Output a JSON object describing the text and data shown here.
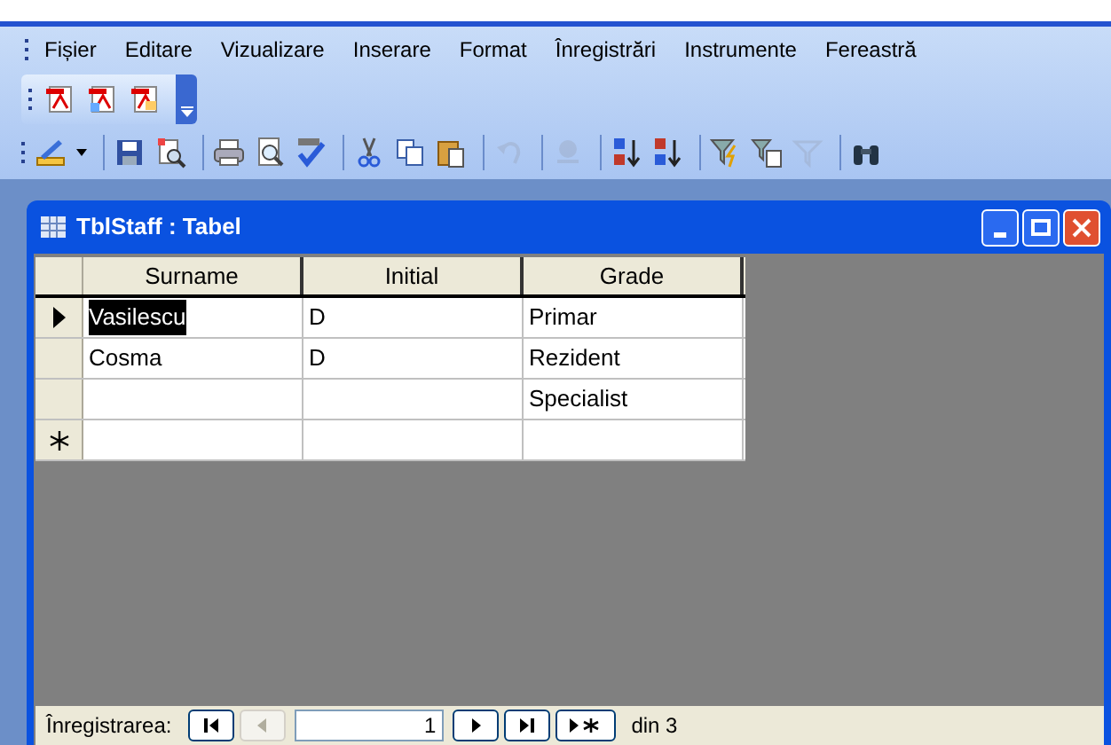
{
  "menu_bar": [
    "Fișier",
    "Editare",
    "Vizualizare",
    "Inserare",
    "Format",
    "Înregistrări",
    "Instrumente",
    "Fereastră"
  ],
  "pdf_toolbar": [
    {
      "kind": "pdf"
    },
    {
      "kind": "pdf-doc"
    },
    {
      "kind": "pdf-mail"
    }
  ],
  "toolbar": [
    {
      "kind": "design",
      "disabled": false
    },
    {
      "kind": "save",
      "disabled": false
    },
    {
      "kind": "search-file",
      "disabled": false
    },
    {
      "kind": "print",
      "disabled": false
    },
    {
      "kind": "preview",
      "disabled": false
    },
    {
      "kind": "spell",
      "disabled": false
    },
    {
      "kind": "cut",
      "disabled": false
    },
    {
      "kind": "copy",
      "disabled": false
    },
    {
      "kind": "paste",
      "disabled": false
    },
    {
      "kind": "undo",
      "disabled": true
    },
    {
      "kind": "link",
      "disabled": true
    },
    {
      "kind": "sort-asc",
      "disabled": false
    },
    {
      "kind": "sort-desc",
      "disabled": false
    },
    {
      "kind": "filter-selection",
      "disabled": false
    },
    {
      "kind": "filter-form",
      "disabled": false
    },
    {
      "kind": "filter",
      "disabled": true
    },
    {
      "kind": "find",
      "disabled": false
    }
  ],
  "window": {
    "title": "TblStaff : Tabel"
  },
  "table": {
    "columns": [
      "Surname",
      "Initial",
      "Grade"
    ],
    "rows": [
      {
        "kind": "record",
        "selected": true,
        "cells": [
          "Vasilescu",
          "D",
          "Primar"
        ]
      },
      {
        "kind": "record",
        "selected": false,
        "cells": [
          "Cosma",
          "D",
          "Rezident"
        ]
      },
      {
        "kind": "record",
        "selected": false,
        "cells": [
          "",
          "",
          "Specialist"
        ]
      },
      {
        "kind": "new",
        "selected": false,
        "cells": [
          "",
          "",
          ""
        ]
      }
    ]
  },
  "navigation": {
    "label": "Înregistrarea:",
    "buttons": [
      {
        "kind": "first",
        "disabled": false
      },
      {
        "kind": "prev",
        "disabled": true
      },
      {
        "kind": "current"
      },
      {
        "kind": "next",
        "disabled": false
      },
      {
        "kind": "last",
        "disabled": false
      },
      {
        "kind": "new",
        "disabled": false
      }
    ],
    "current": "1",
    "total": "din 3"
  }
}
